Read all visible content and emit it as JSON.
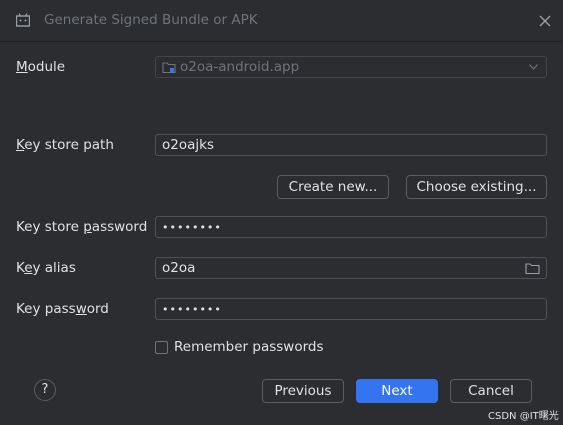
{
  "window": {
    "title": "Generate Signed Bundle or APK"
  },
  "module": {
    "label": "Module",
    "value": "o2oa-android.app"
  },
  "keystore_path": {
    "label": "Key store path",
    "value": "o2oajks"
  },
  "buttons": {
    "create_new": "Create new...",
    "choose_existing": "Choose existing...",
    "previous": "Previous",
    "next": "Next",
    "cancel": "Cancel"
  },
  "keystore_password": {
    "label": "Key store password",
    "value": "••••••••"
  },
  "key_alias": {
    "label": "Key alias",
    "value": "o2oa"
  },
  "key_password": {
    "label": "Key password",
    "value": "••••••••"
  },
  "remember": {
    "label": "Remember passwords",
    "checked": false
  },
  "help": {
    "symbol": "?"
  },
  "watermark": "CSDN @IT曙光",
  "colors": {
    "accent": "#3574f0",
    "background": "#2b2d30",
    "border": "#4e5157"
  }
}
